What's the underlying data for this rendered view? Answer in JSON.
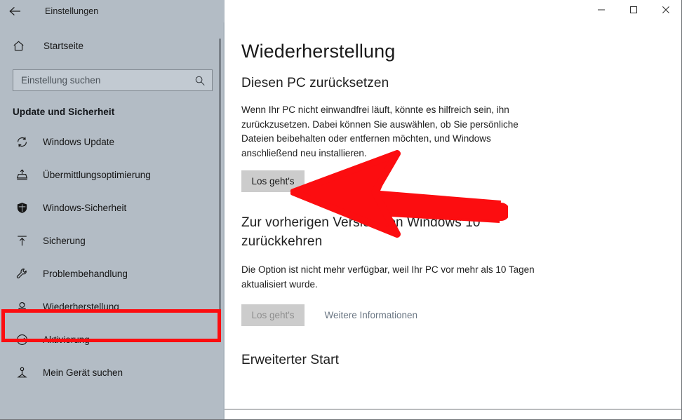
{
  "window": {
    "app_title": "Einstellungen",
    "back_icon": "back-arrow-icon",
    "controls": {
      "minimize": "minimize-icon",
      "maximize": "maximize-icon",
      "close": "close-icon"
    }
  },
  "sidebar": {
    "home": {
      "label": "Startseite",
      "icon": "home-icon"
    },
    "search": {
      "placeholder": "Einstellung suchen",
      "value": "",
      "icon": "search-icon"
    },
    "section_title": "Update und Sicherheit",
    "items": [
      {
        "label": "Windows Update",
        "icon": "sync-icon",
        "selected": false
      },
      {
        "label": "Übermittlungsoptimierung",
        "icon": "delivery-optimization-icon",
        "selected": false
      },
      {
        "label": "Windows-Sicherheit",
        "icon": "shield-icon",
        "selected": false
      },
      {
        "label": "Sicherung",
        "icon": "backup-upload-icon",
        "selected": false
      },
      {
        "label": "Problembehandlung",
        "icon": "wrench-icon",
        "selected": false
      },
      {
        "label": "Wiederherstellung",
        "icon": "recovery-pc-icon",
        "selected": true
      },
      {
        "label": "Aktivierung",
        "icon": "check-circle-icon",
        "selected": false
      },
      {
        "label": "Mein Gerät suchen",
        "icon": "find-my-device-icon",
        "selected": false
      }
    ]
  },
  "main": {
    "page_title": "Wiederherstellung",
    "sections": [
      {
        "heading": "Diesen PC zurücksetzen",
        "body": "Wenn Ihr PC nicht einwandfrei läuft, könnte es hilfreich sein, ihn zurückzusetzen. Dabei können Sie auswählen, ob Sie persönliche Dateien beibehalten oder entfernen möchten, und Windows anschließend neu installieren.",
        "button": "Los geht's"
      },
      {
        "heading": "Zur vorherigen Version von Windows 10 zurückkehren",
        "body": "Die Option ist nicht mehr verfügbar, weil Ihr PC vor mehr als 10 Tagen aktualisiert wurde.",
        "button": "Los geht's",
        "link": "Weitere Informationen"
      },
      {
        "heading": "Erweiterter Start"
      }
    ]
  },
  "annotations": {
    "highlight_color": "#fc0d10",
    "arrow_color": "#fc0d10",
    "highlight_target": "Wiederherstellung",
    "arrow_target": "Los geht's"
  },
  "colors": {
    "sidebar_bg": "#b3bcc5",
    "content_bg": "#ffffff",
    "button_bg": "#cccccc",
    "link": "#6a7683"
  }
}
